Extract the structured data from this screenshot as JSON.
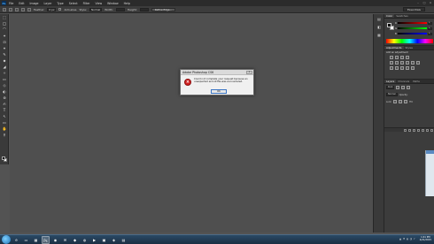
{
  "app": {
    "logo_text": "Ps",
    "menu": [
      "File",
      "Edit",
      "Image",
      "Layer",
      "Type",
      "Select",
      "Filter",
      "View",
      "Window",
      "Help"
    ],
    "window_controls": [
      "–",
      "□",
      "×"
    ]
  },
  "options_bar": {
    "feather_label": "Feather:",
    "feather_value": "0 px",
    "antialias_label": "Anti-alias",
    "style_label": "Style:",
    "style_value": "Normal",
    "width_label": "Width:",
    "height_label": "Height:",
    "refine_edge_label": "Refine Edge...",
    "workspace_label": "Essentials"
  },
  "tools": [
    "⬚",
    "◯",
    "⌒",
    "✦",
    "⊡",
    "⌖",
    "✎",
    "⬥",
    "◢",
    "✧",
    "▭",
    "◇",
    "◐",
    "⊚",
    "✍",
    "T",
    "↖",
    "▭",
    "✋",
    "⚲"
  ],
  "dock_icons": [
    "▤",
    "◧",
    "▦"
  ],
  "color_panel": {
    "tabs": [
      "Color",
      "Swatches"
    ],
    "channels": [
      {
        "name": "R",
        "value": "0",
        "gradient": "#000000-#ff0000"
      },
      {
        "name": "G",
        "value": "0",
        "gradient": "#000000-#00ff00"
      },
      {
        "name": "B",
        "value": "0",
        "gradient": "#000000-#0000ff"
      }
    ]
  },
  "adjustments_panel": {
    "tabs": [
      "Adjustments",
      "Styles"
    ],
    "hint": "Add an adjustment"
  },
  "layers_panel": {
    "tabs": [
      "Layers",
      "Channels",
      "Paths"
    ],
    "filter_label": "Kind",
    "blend_mode": "Normal",
    "opacity_label": "Opacity:",
    "lock_label": "Lock:",
    "fill_label": "Fill:"
  },
  "dialog": {
    "title": "Adobe Photoshop CS6",
    "message": "Could not complete your request because an unexpected end-of-file was encountered.",
    "ok_label": "OK",
    "close_label": "x"
  },
  "taskbar": {
    "tasks": [
      "e",
      "▭",
      "▦",
      "Ps",
      "◉",
      "✉",
      "◆",
      "◍",
      "▶",
      "▣",
      "◈",
      "▤"
    ],
    "active_task": 3,
    "tray_icons": [
      "▲",
      "⚑",
      "▮",
      "◔",
      "♪"
    ],
    "clock_time": "1:41 PM",
    "clock_date": "4/21/2015"
  },
  "colors": {
    "workspace": "#535353",
    "panel": "#3c3c3c",
    "dialog_bg": "#f0f0f0",
    "error_red": "#d12020",
    "taskbar": "#1a2e42"
  }
}
